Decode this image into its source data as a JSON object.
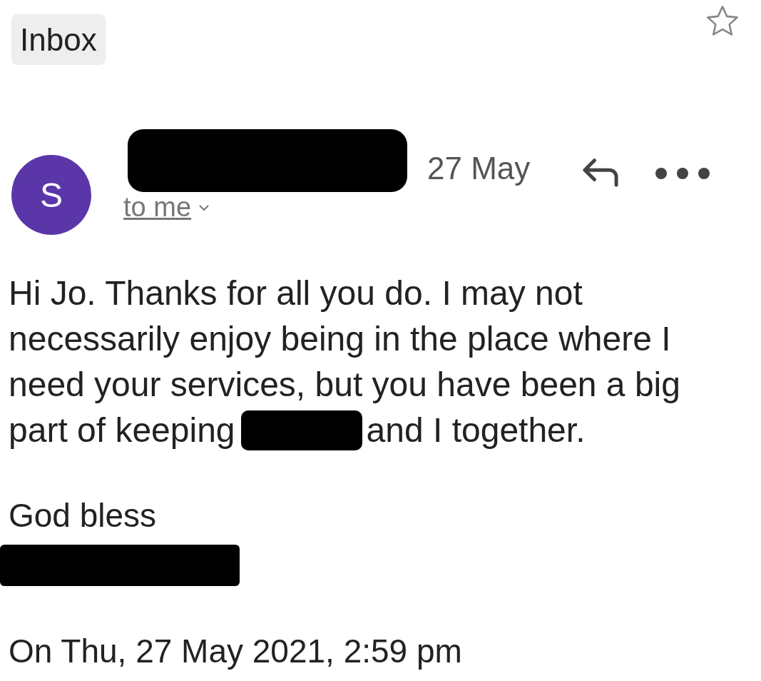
{
  "header": {
    "label": "Inbox",
    "starred": false
  },
  "message": {
    "avatar_letter": "S",
    "date": "27 May",
    "recipient": "to me",
    "body": [
      [
        {
          "kind": "text",
          "text": "Hi Jo. Thanks for all you do. I may not necessarily enjoy being in the place where I need your services, but you have been a big"
        }
      ],
      [
        {
          "kind": "text",
          "text": "part of keeping"
        },
        {
          "kind": "redacted"
        },
        {
          "kind": "text",
          "text": "and I together."
        }
      ]
    ],
    "closing": "God bless",
    "quote_header": "On Thu, 27 May 2021, 2:59 pm"
  }
}
